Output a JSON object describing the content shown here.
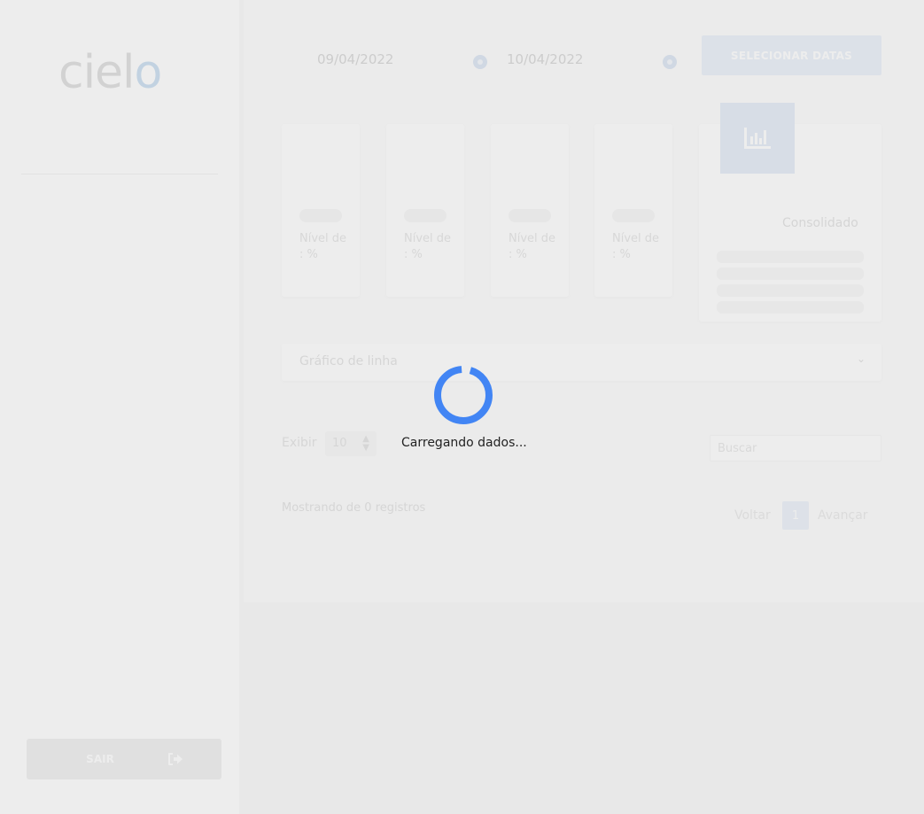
{
  "sidebar": {
    "logo_text_main": "ciel",
    "logo_text_accent": "o",
    "logout_label": "SAIR"
  },
  "dates": {
    "start": "09/04/2022",
    "end": "10/04/2022",
    "select_button": "SELECIONAR DATAS"
  },
  "level_cards": [
    {
      "label": "Nível de : %"
    },
    {
      "label": "Nível de : %"
    },
    {
      "label": "Nível de : %"
    },
    {
      "label": "Nível de : %"
    }
  ],
  "consolidated": {
    "label": "Consolidado"
  },
  "chart_type": {
    "selected": "Gráfico de linha"
  },
  "table": {
    "show_label": "Exibir",
    "page_size": "10",
    "search_placeholder": "Buscar",
    "records_info": "Mostrando de 0 registros",
    "prev_label": "Voltar",
    "current_page": "1",
    "next_label": "Avançar"
  },
  "loading": {
    "text": "Carregando dados..."
  },
  "colors": {
    "spinner": "#4285f4",
    "accent_light": "#dde7f4"
  }
}
